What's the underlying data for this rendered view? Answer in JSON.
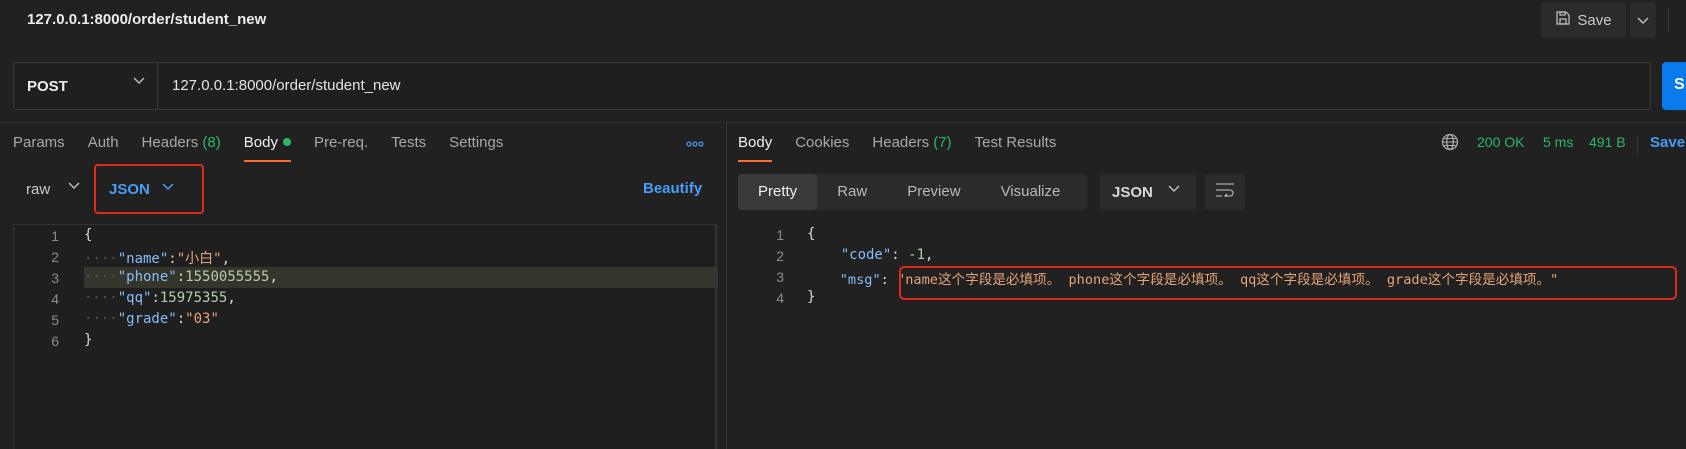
{
  "header": {
    "title": "127.0.0.1:8000/order/student_new",
    "save_label": "Save"
  },
  "request": {
    "method": "POST",
    "url": "127.0.0.1:8000/order/student_new",
    "send_label": "S"
  },
  "req_tabs": [
    {
      "label": "Params"
    },
    {
      "label": "Auth"
    },
    {
      "label": "Headers",
      "count": "(8)"
    },
    {
      "label": "Body"
    },
    {
      "label": "Pre-req."
    },
    {
      "label": "Tests"
    },
    {
      "label": "Settings"
    }
  ],
  "body_options": {
    "mode": "raw",
    "language": "JSON",
    "beautify_label": "Beautify"
  },
  "request_body": {
    "line_numbers": [
      "1",
      "2",
      "3",
      "4",
      "5",
      "6"
    ],
    "brace_open": "{",
    "brace_close": "}",
    "name_key": "\"name\"",
    "name_value": "\"小白\"",
    "phone_key": "\"phone\"",
    "phone_value": "1550055555",
    "qq_key": "\"qq\"",
    "qq_value": "15975355",
    "grade_key": "\"grade\"",
    "grade_value": "\"03\""
  },
  "resp_tabs": [
    {
      "label": "Body"
    },
    {
      "label": "Cookies"
    },
    {
      "label": "Headers",
      "count": "(7)"
    },
    {
      "label": "Test Results"
    }
  ],
  "response_status": {
    "status": "200 OK",
    "time": "5 ms",
    "size": "491 B",
    "save_label": "Save"
  },
  "view_tabs": [
    "Pretty",
    "Raw",
    "Preview",
    "Visualize"
  ],
  "response_format": "JSON",
  "response_body": {
    "line_numbers": [
      "1",
      "2",
      "3",
      "4"
    ],
    "brace_open": "{",
    "brace_close": "}",
    "code_key": "\"code\"",
    "code_value": "-1",
    "msg_key": "\"msg\"",
    "msg_value": "\"name这个字段是必填项。 phone这个字段是必填项。 qq这个字段是必填项。 grade这个字段是必填项。\""
  },
  "colors": {
    "accent": "#ff6c37",
    "link": "#4a9cf4",
    "success": "#2fb56a",
    "highlight_box": "#e02a20",
    "send": "#097bed"
  },
  "icons": [
    "save-icon",
    "chevron-down-icon",
    "globe-icon",
    "more-icon",
    "wrap-icon"
  ]
}
